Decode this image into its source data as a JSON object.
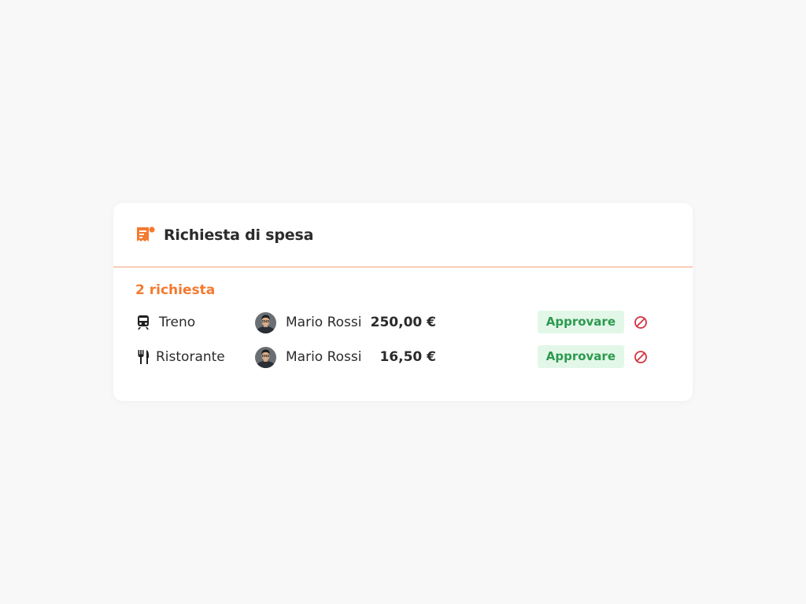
{
  "card": {
    "title": "Richiesta di spesa",
    "title_icon": "receipt-icon",
    "count_label": "2 richiesta"
  },
  "colors": {
    "accent": "#f37a30",
    "approve_bg": "#e3f7e8",
    "approve_text": "#2c9a4f",
    "reject": "#d2343f",
    "text": "#2b2b2b",
    "background": "#f8f8f8"
  },
  "requests": [
    {
      "category": "Treno",
      "category_icon": "train-icon",
      "person": "Mario Rossi",
      "amount": "250,00 €",
      "approve_label": "Approvare",
      "reject_icon": "block-icon"
    },
    {
      "category": "Ristorante",
      "category_icon": "fork-knife-icon",
      "person": "Mario Rossi",
      "amount": "16,50 €",
      "approve_label": "Approvare",
      "reject_icon": "block-icon"
    }
  ]
}
